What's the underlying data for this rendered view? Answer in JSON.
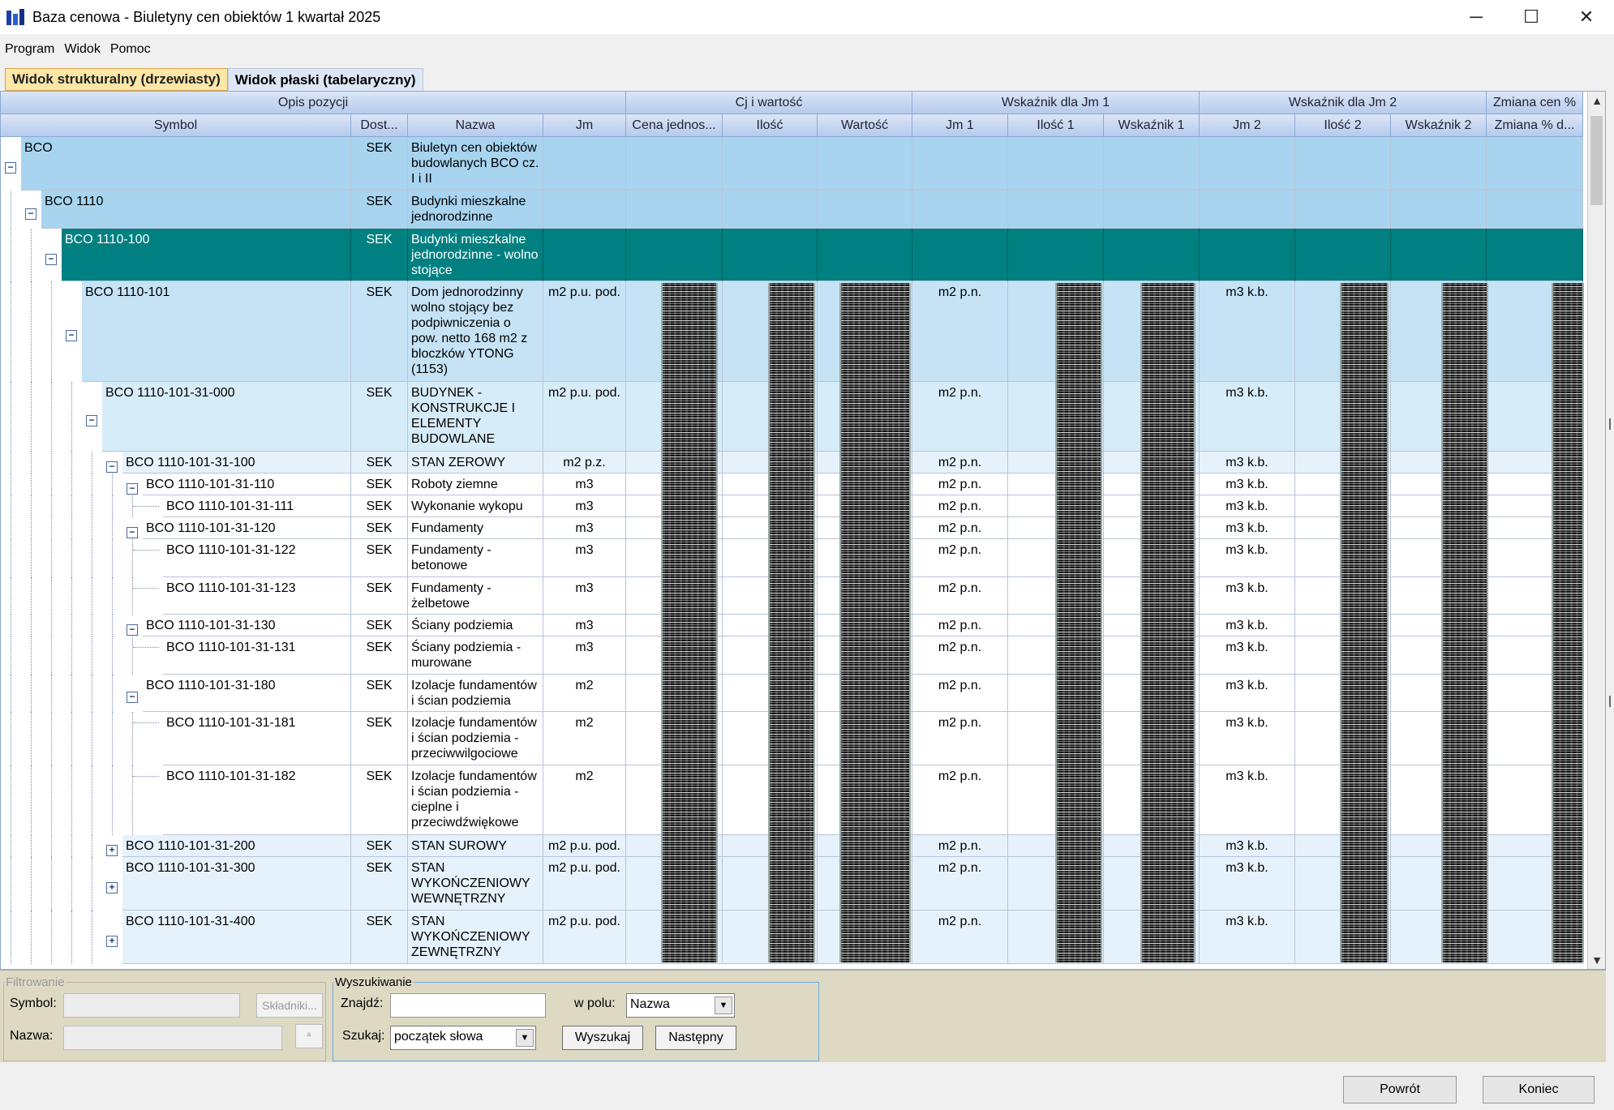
{
  "window": {
    "title": "Baza cenowa - Biuletyny cen obiektów 1 kwartał 2025"
  },
  "menu": [
    "Program",
    "Widok",
    "Pomoc"
  ],
  "tabs": [
    {
      "label": "Widok strukturalny (drzewiasty)",
      "active": true
    },
    {
      "label": "Widok płaski (tabelaryczny)",
      "active": false
    }
  ],
  "bands": [
    "Opis pozycji",
    "Cj i wartość",
    "Wskaźnik dla Jm 1",
    "Wskaźnik dla Jm 2",
    "Zmiana cen %"
  ],
  "columns": [
    "Symbol",
    "Dost...",
    "Nazwa",
    "Jm",
    "Cena jednos...",
    "Ilość",
    "Wartość",
    "Jm 1",
    "Ilość 1",
    "Wskaźnik 1",
    "Jm 2",
    "Ilość 2",
    "Wskaźnik 2",
    "Zmiana % d..."
  ],
  "rows": [
    {
      "symbol": "BCO",
      "dost": "SEK",
      "nazwa": "Biuletyn cen obiektów budowlanych BCO cz. I i II",
      "jm": "",
      "jm1": "",
      "jm2": "",
      "level": 0,
      "toggle": "−",
      "state": "group"
    },
    {
      "symbol": "BCO 1110",
      "dost": "SEK",
      "nazwa": "Budynki mieszkalne jednorodzinne",
      "jm": "",
      "jm1": "",
      "jm2": "",
      "level": 1,
      "toggle": "−",
      "state": "group"
    },
    {
      "symbol": "BCO 1110-100",
      "dost": "SEK",
      "nazwa": "Budynki mieszkalne jednorodzinne - wolno stojące",
      "jm": "",
      "jm1": "",
      "jm2": "",
      "level": 2,
      "toggle": "−",
      "state": "selected"
    },
    {
      "symbol": "BCO 1110-101",
      "dost": "SEK",
      "nazwa": "Dom jednorodzinny wolno stojący bez podpiwniczenia o pow. netto 168 m2 z bloczków YTONG (1153)",
      "jm": "m2 p.u. pod.",
      "jm1": "m2 p.n.",
      "jm2": "m3 k.b.",
      "level": 3,
      "toggle": "−",
      "state": "light"
    },
    {
      "symbol": "BCO 1110-101-31-000",
      "dost": "SEK",
      "nazwa": "BUDYNEK - KONSTRUKCJE I ELEMENTY BUDOWLANE",
      "jm": "m2 p.u. pod.",
      "jm1": "m2 p.n.",
      "jm2": "m3 k.b.",
      "level": 4,
      "toggle": "−",
      "state": "lighter"
    },
    {
      "symbol": "BCO 1110-101-31-100",
      "dost": "SEK",
      "nazwa": "STAN ZEROWY",
      "jm": "m2 p.z.",
      "jm1": "m2 p.n.",
      "jm2": "m3 k.b.",
      "level": 5,
      "toggle": "−",
      "state": "lightest"
    },
    {
      "symbol": "BCO 1110-101-31-110",
      "dost": "SEK",
      "nazwa": "Roboty ziemne",
      "jm": "m3",
      "jm1": "m2 p.n.",
      "jm2": "m3 k.b.",
      "level": 6,
      "toggle": "−",
      "state": "white"
    },
    {
      "symbol": "BCO 1110-101-31-111",
      "dost": "SEK",
      "nazwa": "Wykonanie wykopu",
      "jm": "m3",
      "jm1": "m2 p.n.",
      "jm2": "m3 k.b.",
      "level": 7,
      "toggle": "",
      "state": "white"
    },
    {
      "symbol": "BCO 1110-101-31-120",
      "dost": "SEK",
      "nazwa": "Fundamenty",
      "jm": "m3",
      "jm1": "m2 p.n.",
      "jm2": "m3 k.b.",
      "level": 6,
      "toggle": "−",
      "state": "white"
    },
    {
      "symbol": "BCO 1110-101-31-122",
      "dost": "SEK",
      "nazwa": "Fundamenty - betonowe",
      "jm": "m3",
      "jm1": "m2 p.n.",
      "jm2": "m3 k.b.",
      "level": 7,
      "toggle": "",
      "state": "white"
    },
    {
      "symbol": "BCO 1110-101-31-123",
      "dost": "SEK",
      "nazwa": "Fundamenty - żelbetowe",
      "jm": "m3",
      "jm1": "m2 p.n.",
      "jm2": "m3 k.b.",
      "level": 7,
      "toggle": "",
      "state": "white"
    },
    {
      "symbol": "BCO 1110-101-31-130",
      "dost": "SEK",
      "nazwa": "Ściany podziemia",
      "jm": "m3",
      "jm1": "m2 p.n.",
      "jm2": "m3 k.b.",
      "level": 6,
      "toggle": "−",
      "state": "white"
    },
    {
      "symbol": "BCO 1110-101-31-131",
      "dost": "SEK",
      "nazwa": "Ściany podziemia - murowane",
      "jm": "m3",
      "jm1": "m2 p.n.",
      "jm2": "m3 k.b.",
      "level": 7,
      "toggle": "",
      "state": "white"
    },
    {
      "symbol": "BCO 1110-101-31-180",
      "dost": "SEK",
      "nazwa": "Izolacje fundamentów i ścian podziemia",
      "jm": "m2",
      "jm1": "m2 p.n.",
      "jm2": "m3 k.b.",
      "level": 6,
      "toggle": "−",
      "state": "white"
    },
    {
      "symbol": "BCO 1110-101-31-181",
      "dost": "SEK",
      "nazwa": "Izolacje fundamentów i ścian podziemia - przeciwwilgociowe",
      "jm": "m2",
      "jm1": "m2 p.n.",
      "jm2": "m3 k.b.",
      "level": 7,
      "toggle": "",
      "state": "white"
    },
    {
      "symbol": "BCO 1110-101-31-182",
      "dost": "SEK",
      "nazwa": "Izolacje fundamentów i ścian podziemia - cieplne i przeciwdźwiękowe",
      "jm": "m2",
      "jm1": "m2 p.n.",
      "jm2": "m3 k.b.",
      "level": 7,
      "toggle": "",
      "state": "white"
    },
    {
      "symbol": "BCO 1110-101-31-200",
      "dost": "SEK",
      "nazwa": "STAN SUROWY",
      "jm": "m2 p.u. pod.",
      "jm1": "m2 p.n.",
      "jm2": "m3 k.b.",
      "level": 5,
      "toggle": "+",
      "state": "lightest"
    },
    {
      "symbol": "BCO 1110-101-31-300",
      "dost": "SEK",
      "nazwa": "STAN WYKOŃCZENIOWY WEWNĘTRZNY",
      "jm": "m2 p.u. pod.",
      "jm1": "m2 p.n.",
      "jm2": "m3 k.b.",
      "level": 5,
      "toggle": "+",
      "state": "lightest"
    },
    {
      "symbol": "BCO 1110-101-31-400",
      "dost": "SEK",
      "nazwa": "STAN WYKOŃCZENIOWY ZEWNĘTRZNY",
      "jm": "m2 p.u. pod.",
      "jm1": "m2 p.n.",
      "jm2": "m3 k.b.",
      "level": 5,
      "toggle": "+",
      "state": "lightest"
    }
  ],
  "filter": {
    "legend": "Filtrowanie",
    "symbol_label": "Symbol:",
    "name_label": "Nazwa:",
    "components_button": "Składniki...",
    "small_button": "ª"
  },
  "search": {
    "legend": "Wyszukiwanie",
    "find_label": "Znajdź:",
    "find_value": "",
    "field_label": "w polu:",
    "field_value": "Nazwa",
    "mode_label": "Szukaj:",
    "mode_value": "początek słowa",
    "search_button": "Wyszukaj",
    "next_button": "Następny"
  },
  "footer": {
    "back_button": "Powrót",
    "end_button": "Koniec"
  },
  "colors": {
    "selected": "#008080",
    "group": "#a8d4f0",
    "light": "#c6e3f6",
    "lighter": "#d7ecf9",
    "lightest": "#e6f2fb",
    "white": "#ffffff"
  }
}
